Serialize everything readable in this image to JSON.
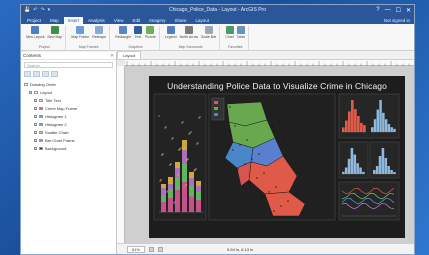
{
  "app": {
    "quick_access": [
      "💾",
      "↶",
      "↷",
      "▾"
    ],
    "window_title": "Chicago_Police_Data - Layout - ArcGIS Pro",
    "window_controls": [
      "?",
      "—",
      "☐",
      "✕"
    ]
  },
  "ribbon_tabs": [
    {
      "label": "Project",
      "active": false
    },
    {
      "label": "Map",
      "active": false
    },
    {
      "label": "Insert",
      "active": true
    },
    {
      "label": "Analysis",
      "active": false
    },
    {
      "label": "View",
      "active": false
    },
    {
      "label": "Edit",
      "active": false
    },
    {
      "label": "Imagery",
      "active": false
    },
    {
      "label": "Share",
      "active": false
    },
    {
      "label": "Layout",
      "active": false
    }
  ],
  "signin": "Not signed in",
  "ribbon_groups": [
    {
      "name": "Project",
      "tools": [
        {
          "label": "New Layout",
          "color": "#4a7fc1"
        },
        {
          "label": "New Map",
          "color": "#3f8e4a"
        }
      ]
    },
    {
      "name": "Map Frames",
      "tools": [
        {
          "label": "Map Frame",
          "color": "#6a9bd8"
        },
        {
          "label": "Reshape",
          "color": "#8aa9cf"
        }
      ]
    },
    {
      "name": "Graphics",
      "tools": [
        {
          "label": "Rectangle",
          "color": "#5b84c4"
        },
        {
          "label": "Text",
          "color": "#2f5e9e"
        },
        {
          "label": "Picture",
          "color": "#6fae5d"
        }
      ]
    },
    {
      "name": "Map Surrounds",
      "tools": [
        {
          "label": "Legend",
          "color": "#4f7fbf"
        },
        {
          "label": "North Arrow",
          "color": "#7a7a7a"
        },
        {
          "label": "Scale Bar",
          "color": "#9aa9b8"
        }
      ]
    },
    {
      "name": "Favorites",
      "tools": [
        {
          "label": "Chart",
          "color": "#4c9a6a"
        },
        {
          "label": "Table",
          "color": "#6f8fb8"
        }
      ]
    }
  ],
  "contents_pane": {
    "title": "Contents",
    "search_placeholder": "Search",
    "items": [
      {
        "label": "Drawing Order",
        "color": "#ffffff",
        "indent": 0
      },
      {
        "label": "Layout",
        "color": "#ffffff",
        "indent": 1
      },
      {
        "label": "Title Text",
        "color": "#d9d9d9",
        "indent": 2
      },
      {
        "label": "Crime Map Frame",
        "color": "#e05a4a",
        "indent": 2
      },
      {
        "label": "Histogram 1",
        "color": "#5aa0d8",
        "indent": 2
      },
      {
        "label": "Histogram 2",
        "color": "#5aa0d8",
        "indent": 2
      },
      {
        "label": "Scatter Chart",
        "color": "#9bd36a",
        "indent": 2
      },
      {
        "label": "Bar Chart Frame",
        "color": "#c77dd8",
        "indent": 2
      },
      {
        "label": "Background",
        "color": "#2c2c2c",
        "indent": 2
      }
    ]
  },
  "layout_view": {
    "tab_label": "Layout",
    "page_title": "Understanding Police Data to Visualize Crime in Chicago"
  },
  "status": {
    "zoom": "61%",
    "coordinates": "9.54 in, 6.13 in"
  }
}
